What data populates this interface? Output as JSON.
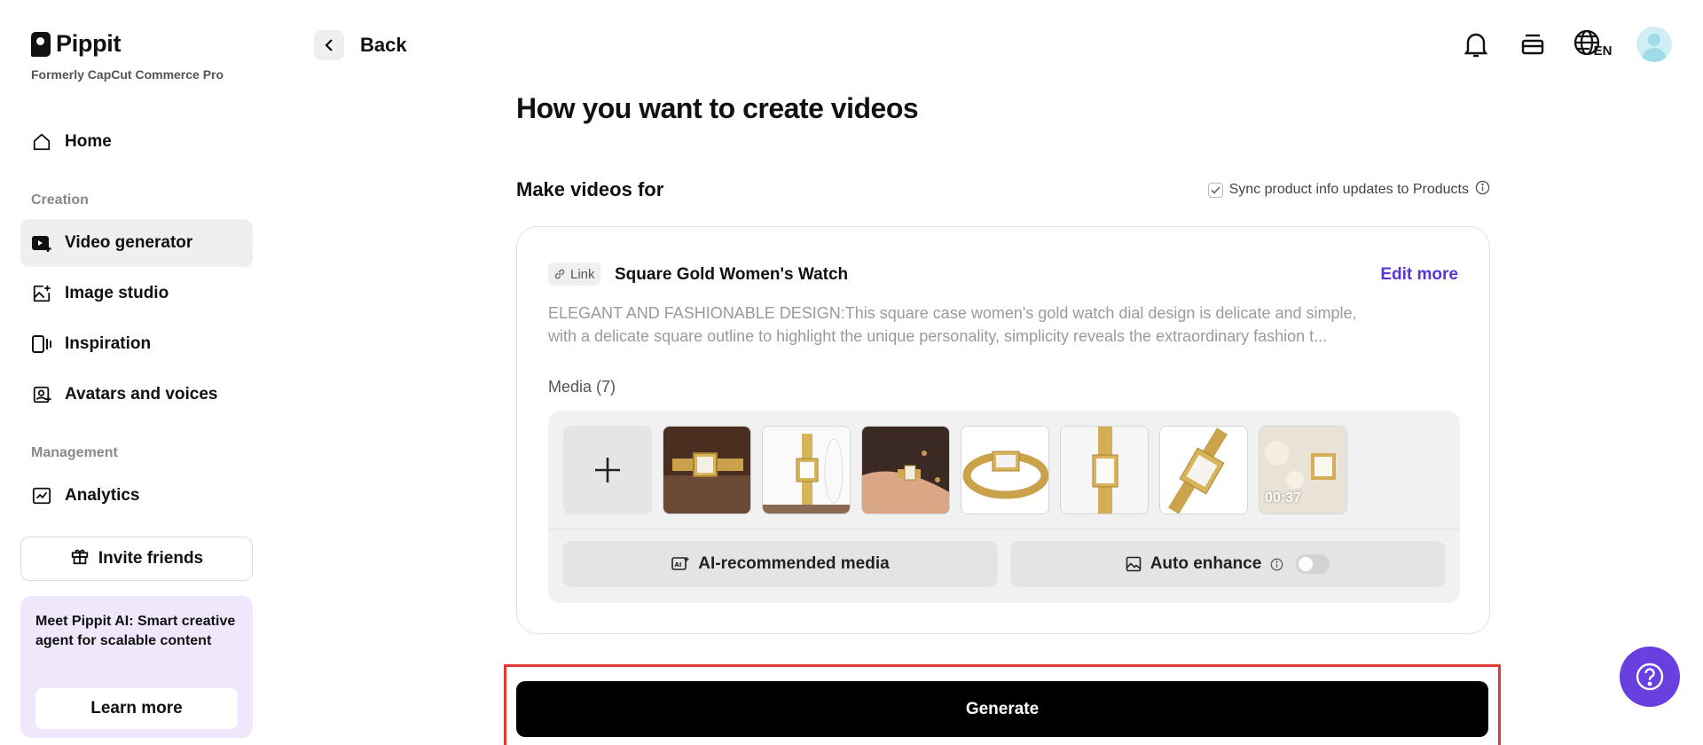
{
  "brand": {
    "name": "Pippit",
    "subtitle": "Formerly CapCut Commerce Pro"
  },
  "sidebar": {
    "home_label": "Home",
    "creation_section": "Creation",
    "creation_items": [
      {
        "label": "Video generator",
        "active": true
      },
      {
        "label": "Image studio"
      },
      {
        "label": "Inspiration"
      },
      {
        "label": "Avatars and voices"
      }
    ],
    "management_section": "Management",
    "management_items": [
      {
        "label": "Analytics"
      }
    ],
    "invite_label": "Invite friends",
    "promo": {
      "lead": "Meet Pippit AI:",
      "text": " Smart creative agent for scalable content",
      "button": "Learn more"
    }
  },
  "topbar": {
    "back_label": "Back",
    "icons": [
      "bell-icon",
      "layers-icon",
      "globe-language-icon",
      "avatar"
    ],
    "language_badge": "EN"
  },
  "main": {
    "title": "How you want to create videos",
    "make_videos_for": "Make videos for",
    "sync_label": "Sync product info updates to Products",
    "sync_checked": true,
    "product": {
      "source_chip": "Link",
      "name": "Square Gold Women's Watch",
      "edit_label": "Edit more",
      "description_line1": "ELEGANT AND FASHIONABLE DESIGN:This square case women's gold watch dial design is delicate and simple,",
      "description_line2": "with a delicate square outline to highlight the unique personality, simplicity reveals the extraordinary fashion t..."
    },
    "media_label": "Media (7)",
    "video_duration": "00:37",
    "ai_media_label": "AI-recommended media",
    "auto_enhance_label": "Auto enhance",
    "auto_enhance_on": false,
    "generate_label": "Generate"
  },
  "colors": {
    "accent": "#5b34d6",
    "help_button": "#6a3fe0",
    "highlight_frame": "#e53935",
    "generate_bg": "#000000"
  }
}
